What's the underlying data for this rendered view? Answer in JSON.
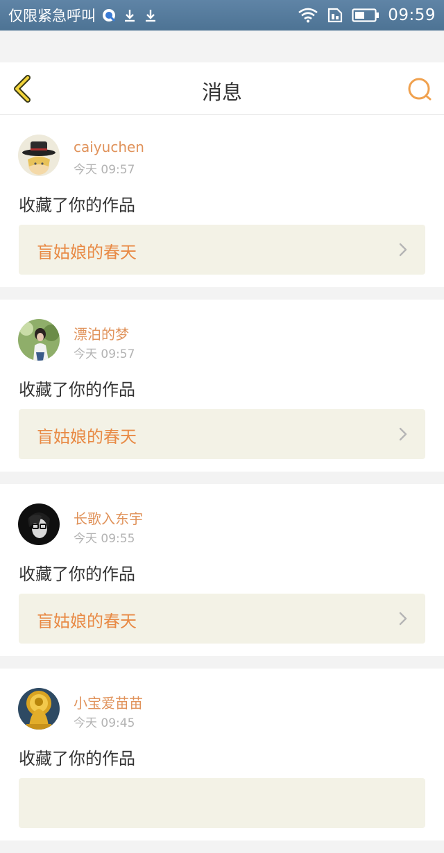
{
  "status_bar": {
    "carrier": "仅限紧急呼叫",
    "time": "09:59",
    "icons": [
      "browser-icon",
      "download-icon",
      "download-icon",
      "wifi-icon",
      "sim-icon",
      "battery-icon"
    ]
  },
  "header": {
    "title": "消息",
    "back_icon": "chevron-left-icon",
    "search_icon": "search-icon"
  },
  "colors": {
    "accent": "#e88a45",
    "username": "#e0925a",
    "link_bg": "#f3f2e6",
    "status_bar": "#5a7fa1"
  },
  "messages": [
    {
      "username": "caiyuchen",
      "time": "今天 09:57",
      "action": "收藏了你的作品",
      "work_title": "盲姑娘的春天",
      "avatar": "anime-avatar"
    },
    {
      "username": "漂泊的梦",
      "time": "今天 09:57",
      "action": "收藏了你的作品",
      "work_title": "盲姑娘的春天",
      "avatar": "photo-avatar"
    },
    {
      "username": "长歌入东宇",
      "time": "今天 09:55",
      "action": "收藏了你的作品",
      "work_title": "盲姑娘的春天",
      "avatar": "dark-avatar"
    },
    {
      "username": "小宝爱苗苗",
      "time": "今天 09:45",
      "action": "收藏了你的作品",
      "work_title": "",
      "avatar": "buddha-avatar"
    }
  ]
}
